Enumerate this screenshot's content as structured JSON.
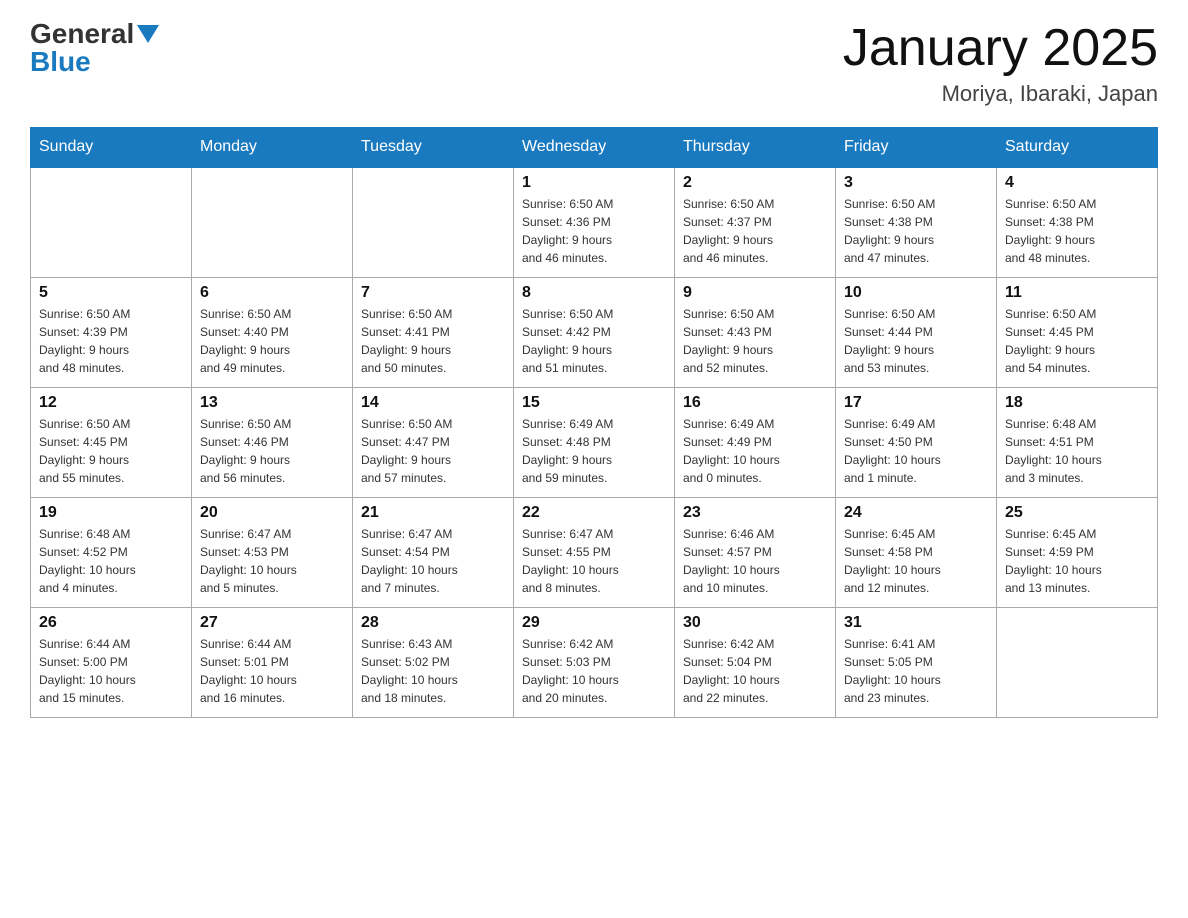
{
  "logo": {
    "general": "General",
    "blue": "Blue"
  },
  "title": "January 2025",
  "subtitle": "Moriya, Ibaraki, Japan",
  "days_of_week": [
    "Sunday",
    "Monday",
    "Tuesday",
    "Wednesday",
    "Thursday",
    "Friday",
    "Saturday"
  ],
  "weeks": [
    [
      {
        "day": "",
        "info": ""
      },
      {
        "day": "",
        "info": ""
      },
      {
        "day": "",
        "info": ""
      },
      {
        "day": "1",
        "info": "Sunrise: 6:50 AM\nSunset: 4:36 PM\nDaylight: 9 hours\nand 46 minutes."
      },
      {
        "day": "2",
        "info": "Sunrise: 6:50 AM\nSunset: 4:37 PM\nDaylight: 9 hours\nand 46 minutes."
      },
      {
        "day": "3",
        "info": "Sunrise: 6:50 AM\nSunset: 4:38 PM\nDaylight: 9 hours\nand 47 minutes."
      },
      {
        "day": "4",
        "info": "Sunrise: 6:50 AM\nSunset: 4:38 PM\nDaylight: 9 hours\nand 48 minutes."
      }
    ],
    [
      {
        "day": "5",
        "info": "Sunrise: 6:50 AM\nSunset: 4:39 PM\nDaylight: 9 hours\nand 48 minutes."
      },
      {
        "day": "6",
        "info": "Sunrise: 6:50 AM\nSunset: 4:40 PM\nDaylight: 9 hours\nand 49 minutes."
      },
      {
        "day": "7",
        "info": "Sunrise: 6:50 AM\nSunset: 4:41 PM\nDaylight: 9 hours\nand 50 minutes."
      },
      {
        "day": "8",
        "info": "Sunrise: 6:50 AM\nSunset: 4:42 PM\nDaylight: 9 hours\nand 51 minutes."
      },
      {
        "day": "9",
        "info": "Sunrise: 6:50 AM\nSunset: 4:43 PM\nDaylight: 9 hours\nand 52 minutes."
      },
      {
        "day": "10",
        "info": "Sunrise: 6:50 AM\nSunset: 4:44 PM\nDaylight: 9 hours\nand 53 minutes."
      },
      {
        "day": "11",
        "info": "Sunrise: 6:50 AM\nSunset: 4:45 PM\nDaylight: 9 hours\nand 54 minutes."
      }
    ],
    [
      {
        "day": "12",
        "info": "Sunrise: 6:50 AM\nSunset: 4:45 PM\nDaylight: 9 hours\nand 55 minutes."
      },
      {
        "day": "13",
        "info": "Sunrise: 6:50 AM\nSunset: 4:46 PM\nDaylight: 9 hours\nand 56 minutes."
      },
      {
        "day": "14",
        "info": "Sunrise: 6:50 AM\nSunset: 4:47 PM\nDaylight: 9 hours\nand 57 minutes."
      },
      {
        "day": "15",
        "info": "Sunrise: 6:49 AM\nSunset: 4:48 PM\nDaylight: 9 hours\nand 59 minutes."
      },
      {
        "day": "16",
        "info": "Sunrise: 6:49 AM\nSunset: 4:49 PM\nDaylight: 10 hours\nand 0 minutes."
      },
      {
        "day": "17",
        "info": "Sunrise: 6:49 AM\nSunset: 4:50 PM\nDaylight: 10 hours\nand 1 minute."
      },
      {
        "day": "18",
        "info": "Sunrise: 6:48 AM\nSunset: 4:51 PM\nDaylight: 10 hours\nand 3 minutes."
      }
    ],
    [
      {
        "day": "19",
        "info": "Sunrise: 6:48 AM\nSunset: 4:52 PM\nDaylight: 10 hours\nand 4 minutes."
      },
      {
        "day": "20",
        "info": "Sunrise: 6:47 AM\nSunset: 4:53 PM\nDaylight: 10 hours\nand 5 minutes."
      },
      {
        "day": "21",
        "info": "Sunrise: 6:47 AM\nSunset: 4:54 PM\nDaylight: 10 hours\nand 7 minutes."
      },
      {
        "day": "22",
        "info": "Sunrise: 6:47 AM\nSunset: 4:55 PM\nDaylight: 10 hours\nand 8 minutes."
      },
      {
        "day": "23",
        "info": "Sunrise: 6:46 AM\nSunset: 4:57 PM\nDaylight: 10 hours\nand 10 minutes."
      },
      {
        "day": "24",
        "info": "Sunrise: 6:45 AM\nSunset: 4:58 PM\nDaylight: 10 hours\nand 12 minutes."
      },
      {
        "day": "25",
        "info": "Sunrise: 6:45 AM\nSunset: 4:59 PM\nDaylight: 10 hours\nand 13 minutes."
      }
    ],
    [
      {
        "day": "26",
        "info": "Sunrise: 6:44 AM\nSunset: 5:00 PM\nDaylight: 10 hours\nand 15 minutes."
      },
      {
        "day": "27",
        "info": "Sunrise: 6:44 AM\nSunset: 5:01 PM\nDaylight: 10 hours\nand 16 minutes."
      },
      {
        "day": "28",
        "info": "Sunrise: 6:43 AM\nSunset: 5:02 PM\nDaylight: 10 hours\nand 18 minutes."
      },
      {
        "day": "29",
        "info": "Sunrise: 6:42 AM\nSunset: 5:03 PM\nDaylight: 10 hours\nand 20 minutes."
      },
      {
        "day": "30",
        "info": "Sunrise: 6:42 AM\nSunset: 5:04 PM\nDaylight: 10 hours\nand 22 minutes."
      },
      {
        "day": "31",
        "info": "Sunrise: 6:41 AM\nSunset: 5:05 PM\nDaylight: 10 hours\nand 23 minutes."
      },
      {
        "day": "",
        "info": ""
      }
    ]
  ]
}
